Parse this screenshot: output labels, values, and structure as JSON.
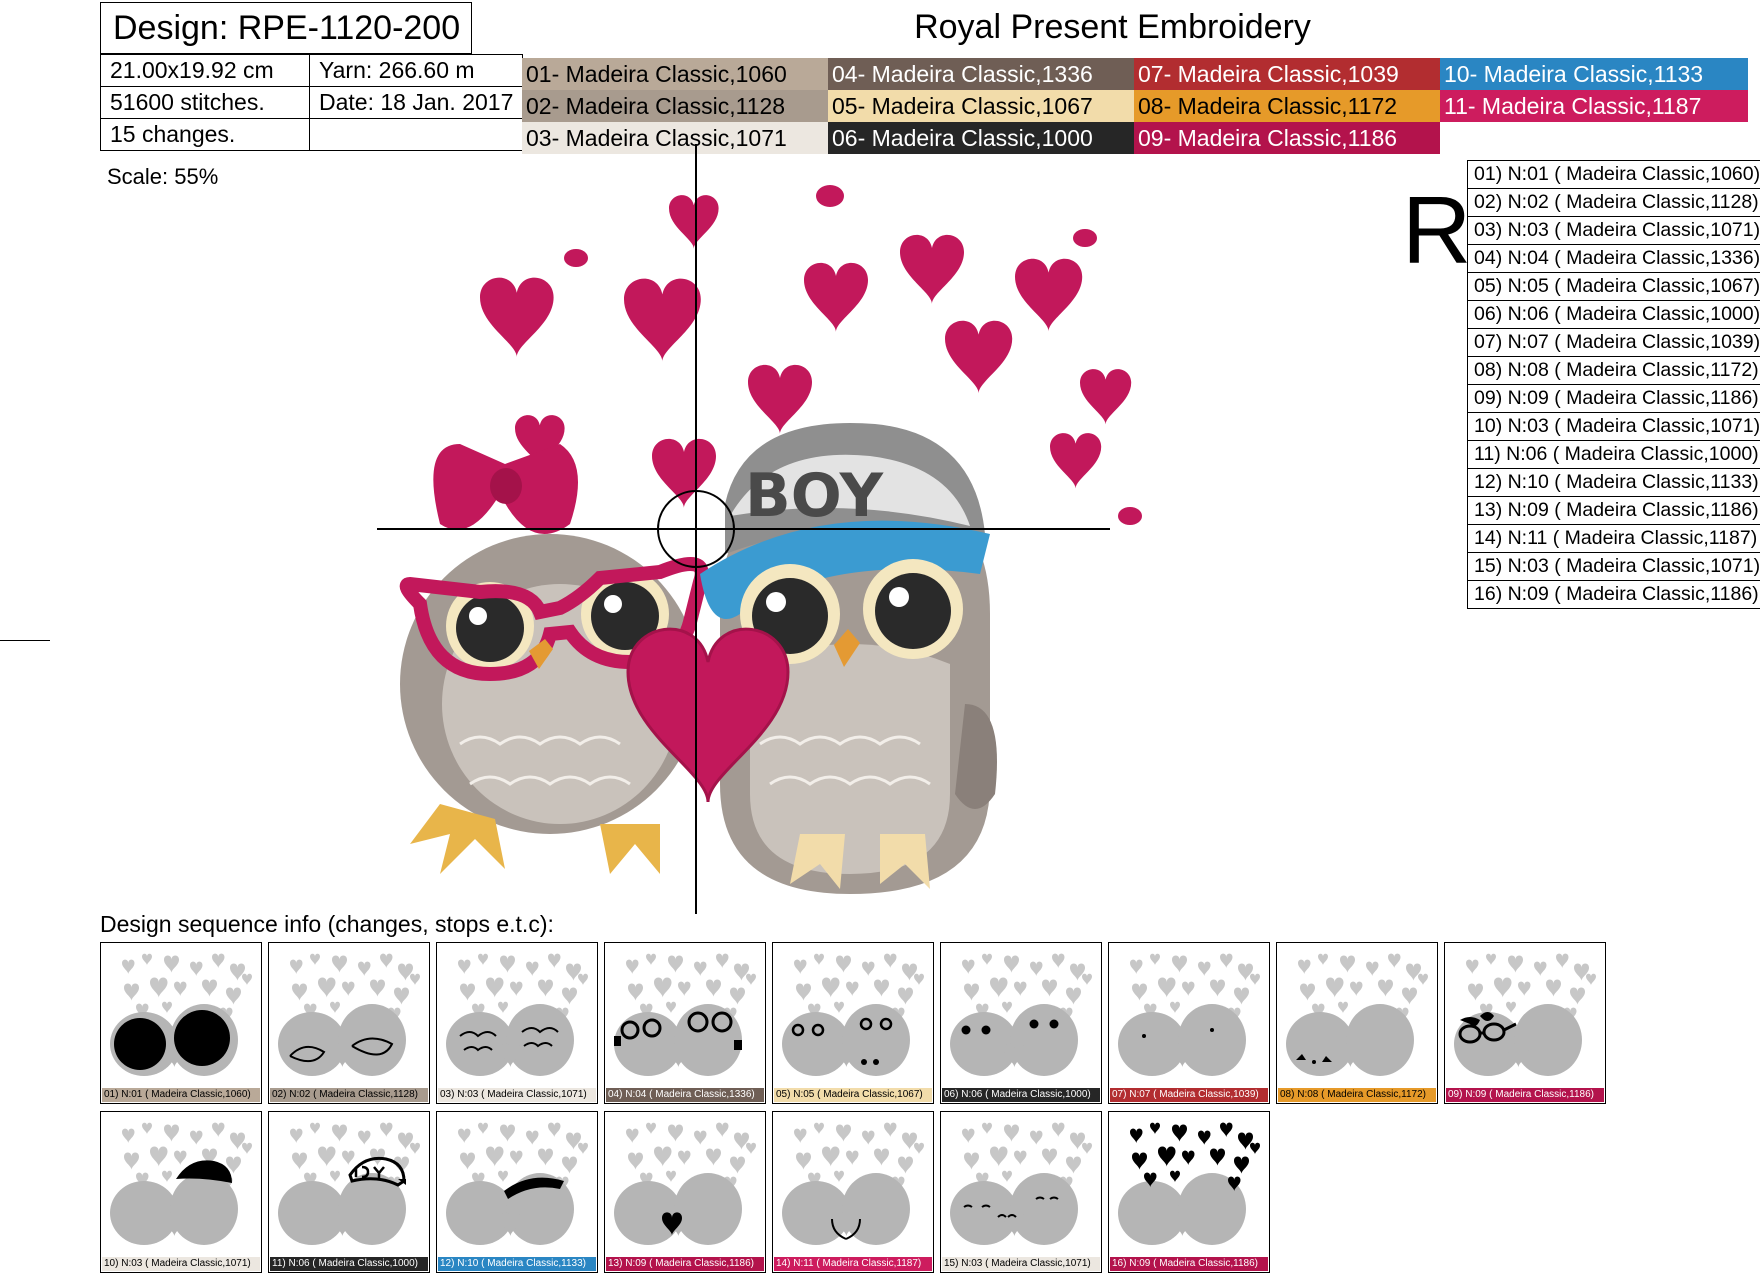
{
  "header": {
    "design": "Design: RPE-1120-200",
    "company": "Royal Present Embroidery"
  },
  "info": {
    "size": "21.00x19.92 cm",
    "yarn": "Yarn: 266.60 m",
    "stitches": "51600 stitches.",
    "date": "Date: 18 Jan. 2017",
    "changes": "15 changes."
  },
  "colors": [
    {
      "label": "01- Madeira Classic,1060",
      "bg": "#b9a998",
      "fg": "#000000"
    },
    {
      "label": "04- Madeira Classic,1336",
      "bg": "#6f5e55",
      "fg": "#ffffff"
    },
    {
      "label": "07- Madeira Classic,1039",
      "bg": "#b22d30",
      "fg": "#ffffff"
    },
    {
      "label": "10- Madeira Classic,1133",
      "bg": "#2a86c3",
      "fg": "#ffffff"
    },
    {
      "label": "02- Madeira Classic,1128",
      "bg": "#a89b8e",
      "fg": "#000000"
    },
    {
      "label": "05- Madeira Classic,1067",
      "bg": "#f2dcaa",
      "fg": "#000000"
    },
    {
      "label": "08- Madeira Classic,1172",
      "bg": "#e69a29",
      "fg": "#000000"
    },
    {
      "label": "11- Madeira Classic,1187",
      "bg": "#cd1c5e",
      "fg": "#ffffff"
    },
    {
      "label": "03- Madeira Classic,1071",
      "bg": "#ece7e0",
      "fg": "#000000"
    },
    {
      "label": "06- Madeira Classic,1000",
      "bg": "#262626",
      "fg": "#ffffff"
    },
    {
      "label": "09- Madeira Classic,1186",
      "bg": "#b3134c",
      "fg": "#ffffff"
    },
    {
      "label": "",
      "bg": "#ffffff",
      "fg": "#000000"
    }
  ],
  "scale": "Scale: 55%",
  "rotation_mark": "R",
  "design_text": "BOY",
  "sequence": [
    "01) N:01 ( Madeira Classic,1060)",
    "02) N:02 ( Madeira Classic,1128)",
    "03) N:03 ( Madeira Classic,1071)",
    "04) N:04 ( Madeira Classic,1336)",
    "05) N:05 ( Madeira Classic,1067)",
    "06) N:06 ( Madeira Classic,1000)",
    "07) N:07 ( Madeira Classic,1039)",
    "08) N:08 ( Madeira Classic,1172)",
    "09) N:09 ( Madeira Classic,1186)",
    "10) N:03 ( Madeira Classic,1071)",
    "11) N:06 ( Madeira Classic,1000)",
    "12) N:10 ( Madeira Classic,1133)",
    "13) N:09 ( Madeira Classic,1186)",
    "14) N:11 ( Madeira Classic,1187)",
    "15) N:03 ( Madeira Classic,1071)",
    "16) N:09 ( Madeira Classic,1186)"
  ],
  "sequence_title": "Design sequence info (changes, stops e.t.c):",
  "thumbnails": [
    {
      "caption": "01) N:01 ( Madeira Classic,1060)",
      "bg": "#b9a998",
      "fg": "#000000",
      "part": "bodies"
    },
    {
      "caption": "02) N:02 ( Madeira Classic,1128)",
      "bg": "#a89b8e",
      "fg": "#000000",
      "part": "belly-outline"
    },
    {
      "caption": "03) N:03 ( Madeira Classic,1071)",
      "bg": "#ece7e0",
      "fg": "#000000",
      "part": "feathers"
    },
    {
      "caption": "04) N:04 ( Madeira Classic,1336)",
      "bg": "#6f5e55",
      "fg": "#ffffff",
      "part": "eye-rings"
    },
    {
      "caption": "05) N:05 ( Madeira Classic,1067)",
      "bg": "#f2dcaa",
      "fg": "#000000",
      "part": "eyes-feet"
    },
    {
      "caption": "06) N:06 ( Madeira Classic,1000)",
      "bg": "#262626",
      "fg": "#ffffff",
      "part": "pupils"
    },
    {
      "caption": "07) N:07 ( Madeira Classic,1039)",
      "bg": "#b22d30",
      "fg": "#ffffff",
      "part": "beaks"
    },
    {
      "caption": "08) N:08 ( Madeira Classic,1172)",
      "bg": "#e69a29",
      "fg": "#000000",
      "part": "feet"
    },
    {
      "caption": "09) N:09 ( Madeira Classic,1186)",
      "bg": "#b3134c",
      "fg": "#ffffff",
      "part": "glasses-bow"
    },
    {
      "caption": "10) N:03 ( Madeira Classic,1071)",
      "bg": "#ece7e0",
      "fg": "#000000",
      "part": "cap"
    },
    {
      "caption": "11) N:06 ( Madeira Classic,1000)",
      "bg": "#262626",
      "fg": "#ffffff",
      "part": "cap-text"
    },
    {
      "caption": "12) N:10 ( Madeira Classic,1133)",
      "bg": "#2a86c3",
      "fg": "#ffffff",
      "part": "visor"
    },
    {
      "caption": "13) N:09 ( Madeira Classic,1186)",
      "bg": "#b3134c",
      "fg": "#ffffff",
      "part": "heart"
    },
    {
      "caption": "14) N:11 ( Madeira Classic,1187)",
      "bg": "#cd1c5e",
      "fg": "#ffffff",
      "part": "heart-outline"
    },
    {
      "caption": "15) N:03 ( Madeira Classic,1071)",
      "bg": "#ece7e0",
      "fg": "#000000",
      "part": "details"
    },
    {
      "caption": "16) N:09 ( Madeira Classic,1186)",
      "bg": "#b3134c",
      "fg": "#ffffff",
      "part": "small-hearts"
    }
  ]
}
